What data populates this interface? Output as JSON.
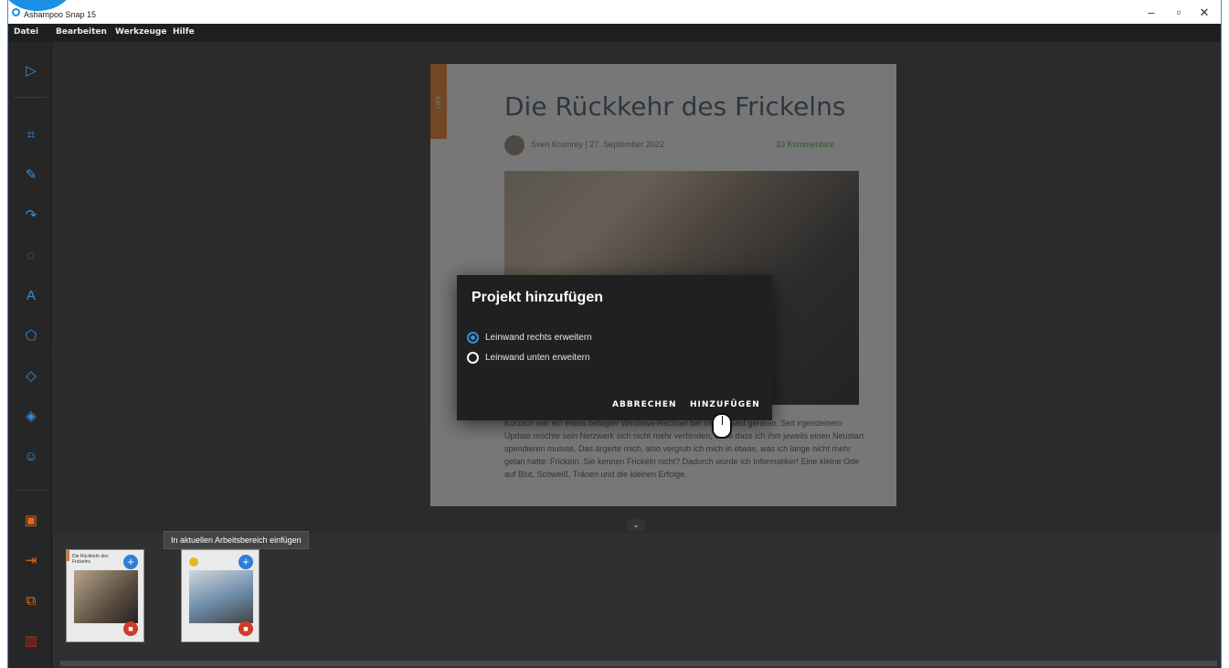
{
  "window": {
    "title": "Ashampoo Snap 15",
    "controls": {
      "minimize": "–",
      "maximize": "▫",
      "close": "✕"
    }
  },
  "menu": {
    "items": [
      "Datei",
      "Bearbeiten",
      "Werkzeuge",
      "Hilfe"
    ]
  },
  "toolbar": {
    "tools": [
      "select-icon",
      "crop-icon",
      "pen-icon",
      "arrow-icon",
      "blur-icon",
      "text-icon",
      "shape-icon",
      "eraser-icon",
      "fill-icon",
      "emoji-icon"
    ],
    "actions": [
      "save-icon",
      "export-icon",
      "copy-icon",
      "delete-icon"
    ]
  },
  "article": {
    "category": "LIFE",
    "title": "Die Rückkehr des Frickelns",
    "author_date": "Sven Krumrey | 27. September 2022",
    "comments": "33 Kommentare",
    "body": "Kürzlich war ein etwas betagter Windows-Rechner bei mir zu Gast geraten. Seit irgendeinem Update mochte sein Netzwerk sich nicht mehr verbinden, ohne dass ich ihm jeweils einen Neustart spendieren musste. Das ärgerte mich, also vergrub ich mich in etwas, was ich lange nicht mehr getan hatte: Frickeln. Sie kennen Frickeln nicht? Dadurch wurde ich Informatiker! Eine kleine Ode auf Blut, Schweiß, Tränen und die kleinen Erfolge."
  },
  "dialog": {
    "title": "Projekt hinzufügen",
    "options": [
      {
        "label": "Leinwand rechts erweitern",
        "checked": true
      },
      {
        "label": "Leinwand unten erweitern",
        "checked": false
      }
    ],
    "cancel": "ABBRECHEN",
    "confirm": "HINZUFÜGEN"
  },
  "tray": {
    "tooltip": "In aktuellen Arbeitsbereich einfügen",
    "thumbs": [
      {
        "title": "Die Rückkehr des Frickelns"
      },
      {
        "title": ""
      }
    ]
  },
  "colors": {
    "accent": "#3a8fd8",
    "orange": "#e8721e",
    "background": "#2a2a2a"
  }
}
